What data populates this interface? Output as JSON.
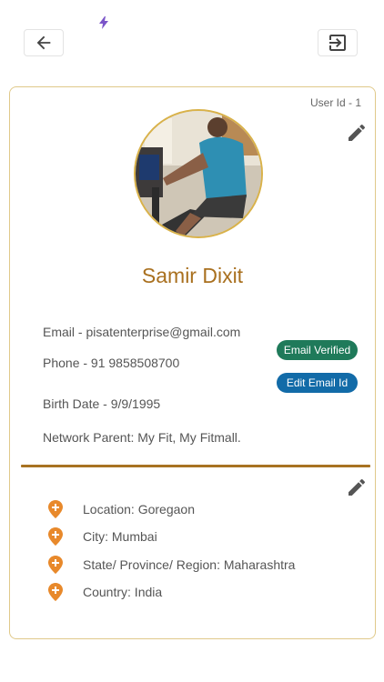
{
  "header": {
    "back_icon": "arrow-left-icon",
    "logout_icon": "logout-icon",
    "status_icon": "bolt-icon"
  },
  "profile": {
    "user_id": "User Id - 1",
    "name": "Samir Dixit",
    "email": "Email - pisatenterprise@gmail.com",
    "phone": "Phone - 91 9858508700",
    "birth_date": "Birth Date - 9/9/1995",
    "network_parent": "Network Parent: My Fit, My Fitmall.",
    "email_verified_label": "Email Verified",
    "edit_email_label": "Edit Email Id"
  },
  "location": {
    "items": [
      {
        "label": "Location: Goregaon"
      },
      {
        "label": "City: Mumbai"
      },
      {
        "label": "State/ Province/ Region: Maharashtra"
      },
      {
        "label": "Country: India"
      }
    ]
  },
  "colors": {
    "accent": "#a9701f",
    "verified": "#1f7a5a",
    "edit_email": "#126ba8",
    "pin": "#e8892b",
    "card_border": "#e0c98a"
  }
}
